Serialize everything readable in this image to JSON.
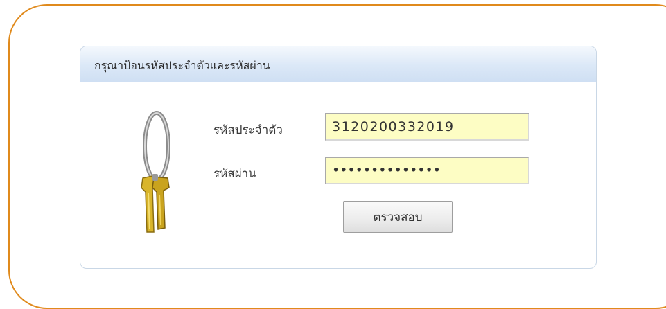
{
  "login": {
    "title": "กรุณาป้อนรหัสประจำตัวและรหัสผ่าน",
    "id_label": "รหัสประจำตัว",
    "id_value": "3120200332019",
    "password_label": "รหัสผ่าน",
    "password_value": "••••••••••••••",
    "submit_label": "ตรวจสอบ"
  },
  "colors": {
    "frame_border": "#e08a1c",
    "field_background": "#fdfdc4",
    "header_gradient": "#dbe8f7"
  },
  "icons": {
    "illustration": "keys-icon"
  }
}
